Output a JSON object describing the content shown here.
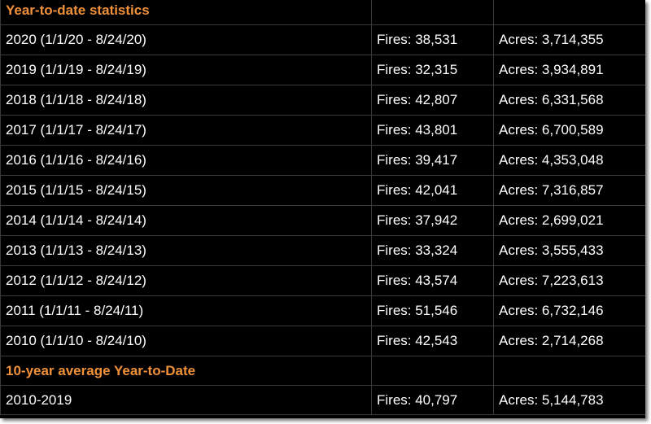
{
  "section_ytd": {
    "title": "Year-to-date statistics"
  },
  "rows": [
    {
      "period": "2020 (1/1/20 - 8/24/20)",
      "fires": "Fires: 38,531",
      "acres": "Acres: 3,714,355"
    },
    {
      "period": "2019 (1/1/19 - 8/24/19)",
      "fires": "Fires: 32,315",
      "acres": "Acres: 3,934,891"
    },
    {
      "period": "2018 (1/1/18 - 8/24/18)",
      "fires": "Fires: 42,807",
      "acres": "Acres: 6,331,568"
    },
    {
      "period": "2017 (1/1/17 - 8/24/17)",
      "fires": "Fires: 43,801",
      "acres": "Acres: 6,700,589"
    },
    {
      "period": "2016 (1/1/16 - 8/24/16)",
      "fires": "Fires: 39,417",
      "acres": "Acres: 4,353,048"
    },
    {
      "period": "2015 (1/1/15 - 8/24/15)",
      "fires": "Fires: 42,041",
      "acres": "Acres: 7,316,857"
    },
    {
      "period": "2014 (1/1/14 - 8/24/14)",
      "fires": "Fires: 37,942",
      "acres": "Acres: 2,699,021"
    },
    {
      "period": "2013 (1/1/13 - 8/24/13)",
      "fires": "Fires: 33,324",
      "acres": "Acres: 3,555,433"
    },
    {
      "period": "2012 (1/1/12 - 8/24/12)",
      "fires": "Fires: 43,574",
      "acres": "Acres: 7,223,613"
    },
    {
      "period": "2011 (1/1/11 - 8/24/11)",
      "fires": "Fires: 51,546",
      "acres": "Acres: 6,732,146"
    },
    {
      "period": "2010 (1/1/10 - 8/24/10)",
      "fires": "Fires: 42,543",
      "acres": "Acres: 2,714,268"
    }
  ],
  "section_avg": {
    "title": "10-year average Year-to-Date"
  },
  "average": {
    "period": "2010-2019",
    "fires": "Fires: 40,797",
    "acres": "Acres: 5,144,783"
  },
  "colors": {
    "background": "#000000",
    "heading": "#f0913a",
    "text": "#ffffff",
    "border": "#3a3a3a"
  }
}
